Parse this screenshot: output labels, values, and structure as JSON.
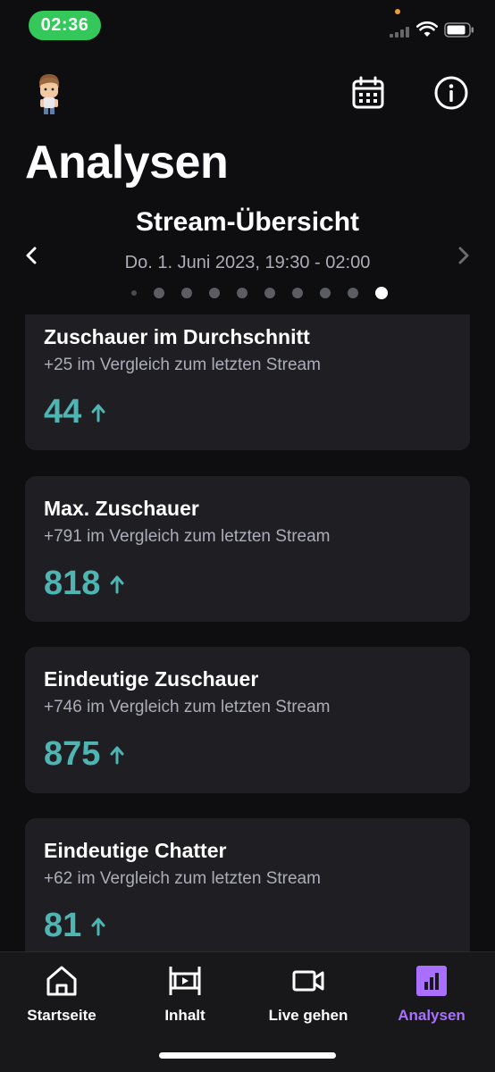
{
  "status_bar": {
    "time": "02:36"
  },
  "header": {
    "title": "Analysen"
  },
  "overview": {
    "title": "Stream-Übersicht",
    "date_range": "Do. 1. Juni 2023, 19:30 - 02:00",
    "page_count": 10,
    "active_page": 10
  },
  "cards": [
    {
      "title": "Zuschauer im Durchschnitt",
      "comparison": "+25 im Vergleich zum letzten Stream",
      "value": "44",
      "trend": "up"
    },
    {
      "title": "Max. Zuschauer",
      "comparison": "+791 im Vergleich zum letzten Stream",
      "value": "818",
      "trend": "up"
    },
    {
      "title": "Eindeutige Zuschauer",
      "comparison": "+746 im Vergleich zum letzten Stream",
      "value": "875",
      "trend": "up"
    },
    {
      "title": "Eindeutige Chatter",
      "comparison": "+62 im Vergleich zum letzten Stream",
      "value": "81",
      "trend": "up"
    }
  ],
  "tabbar": {
    "tabs": [
      {
        "label": "Startseite",
        "icon": "home-icon"
      },
      {
        "label": "Inhalt",
        "icon": "film-icon"
      },
      {
        "label": "Live gehen",
        "icon": "video-camera-icon"
      },
      {
        "label": "Analysen",
        "icon": "bar-chart-icon",
        "active": true
      }
    ]
  },
  "colors": {
    "accent": "#a970ff",
    "positive": "#4fb5b2",
    "background": "#0e0e10",
    "card": "#1f1f23",
    "status_pill": "#34c759"
  }
}
